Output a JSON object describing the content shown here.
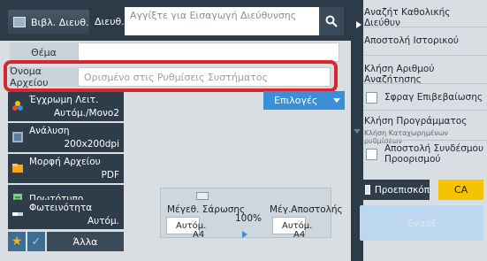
{
  "header": {
    "address_book_label": "Βιβλ. Διευθ.",
    "destination_label": "Διευθ.",
    "address_placeholder": "Αγγίξτε για Εισαγωγή Διεύθυνσης"
  },
  "form": {
    "subject_label": "Θέμα",
    "subject_value": "",
    "filename_label": "Όνομα Αρχείου",
    "filename_placeholder": "Ορισμένο στις Ρυθμίσεις Συστήματος"
  },
  "options_label": "Επιλογές",
  "settings": [
    {
      "label": "Έγχρωμη Λειτ.",
      "value": "Αυτόμ./Μονο2",
      "icon": "color-mode-icon"
    },
    {
      "label": "Ανάλυση",
      "value": "200x200dpi",
      "icon": "resolution-icon"
    },
    {
      "label": "Μορφή Αρχείου",
      "value": "PDF",
      "icon": "file-format-icon"
    },
    {
      "label": "Πρωτότυπο",
      "value": "",
      "icon": "original-icon"
    },
    {
      "label": "Φωτεινότητα",
      "value": "Αυτόμ.",
      "icon": "exposure-icon"
    }
  ],
  "bottom_strip": {
    "other_label": "Άλλα"
  },
  "scan_panel": {
    "scan_size_label": "Μέγεθ. Σάρωσης",
    "send_size_label": "Μέγ.Αποστολής",
    "ratio": "100%",
    "scan_auto": "Αυτόμ.",
    "scan_paper": "A4",
    "send_auto": "Αυτόμ.",
    "send_paper": "A4"
  },
  "right_panel": {
    "items": [
      "Αναζήτ Καθολικής Διεύθυν",
      "Αποστολή Ιστορικού",
      "Κλήση Αριθμού Αναζήτησης",
      "Σφραγ Επιβεβαίωσης",
      "Κλήση Προγράμματος",
      "Κλήση Καταχωρημένων ρυθμίσεων",
      "Αποστολή Συνδέσμου Προορισμού"
    ],
    "preview_label": "Προεπισκόπ",
    "ca_label": "CA",
    "send_label": "Έναρξ"
  },
  "colors": {
    "highlight": "#d8262f",
    "accent": "#3b8fd9",
    "ca": "#f5c400"
  }
}
